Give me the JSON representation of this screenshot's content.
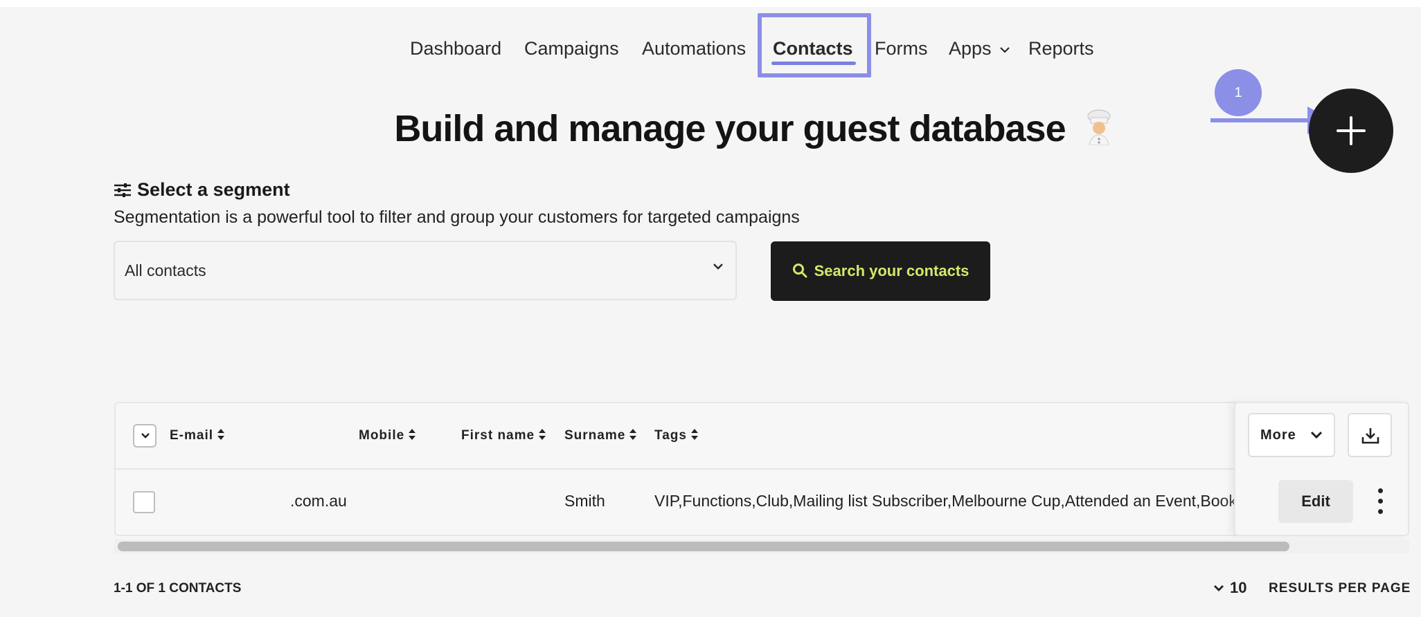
{
  "nav": {
    "items": [
      {
        "label": "Dashboard"
      },
      {
        "label": "Campaigns"
      },
      {
        "label": "Automations"
      },
      {
        "label": "Contacts",
        "active": true
      },
      {
        "label": "Forms"
      },
      {
        "label": "Apps"
      },
      {
        "label": "Reports"
      }
    ]
  },
  "page": {
    "title": "Build and manage your guest database"
  },
  "annotation": {
    "badge": "1"
  },
  "segment": {
    "heading": "Select a segment",
    "description": "Segmentation is a powerful tool to filter and group your customers for targeted campaigns",
    "selected": "All contacts",
    "search_label": "Search your contacts"
  },
  "table": {
    "columns": [
      "E-mail",
      "Mobile",
      "First name",
      "Surname",
      "Tags"
    ],
    "rows": [
      {
        "email": ".com.au",
        "mobile": "",
        "first_name": "",
        "surname": "Smith",
        "tags": "VIP,Functions,Club,Mailing list Subscriber,Melbourne Cup,Attended an Event,Booked F"
      }
    ],
    "more_label": "More",
    "edit_label": "Edit"
  },
  "pagination": {
    "count": "1-1 OF 1 CONTACTS",
    "per_page": "10",
    "per_page_label": "RESULTS PER PAGE"
  },
  "colors": {
    "accent": "#8b8fe6",
    "dark": "#1c1c1c",
    "search_text": "#d6e86a"
  }
}
